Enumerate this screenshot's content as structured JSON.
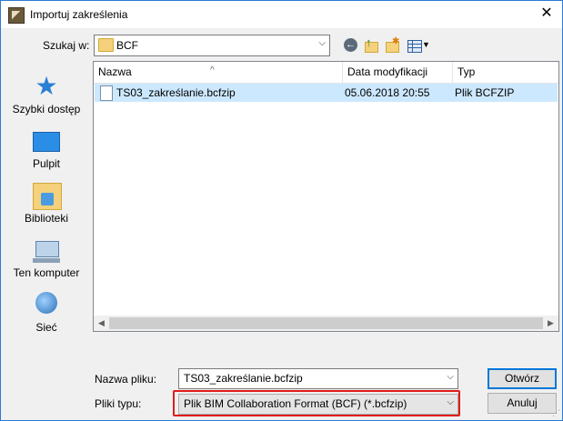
{
  "window": {
    "title": "Importuj zakreślenia",
    "close_glyph": "✕"
  },
  "toolbar": {
    "lookin_label": "Szukaj w:",
    "lookin_value": "BCF",
    "icons": [
      "back-icon",
      "up-folder-icon",
      "new-folder-icon",
      "view-menu-icon"
    ]
  },
  "places": [
    {
      "label": "Szybki dostęp",
      "icon": "quick-access-star-icon"
    },
    {
      "label": "Pulpit",
      "icon": "desktop-icon"
    },
    {
      "label": "Biblioteki",
      "icon": "libraries-icon"
    },
    {
      "label": "Ten komputer",
      "icon": "computer-icon"
    },
    {
      "label": "Sieć",
      "icon": "network-icon"
    }
  ],
  "filelist": {
    "columns": [
      "Nazwa",
      "Data modyfikacji",
      "Typ"
    ],
    "rows": [
      {
        "name": "TS03_zakreślanie.bcfzip",
        "date": "05.06.2018 20:55",
        "type": "Plik BCFZIP",
        "selected": true
      }
    ]
  },
  "footer": {
    "filename_label": "Nazwa pliku:",
    "filename_value": "TS03_zakreślanie.bcfzip",
    "filetype_label": "Pliki typu:",
    "filetype_value": "Plik BIM Collaboration Format (BCF) (*.bcfzip)",
    "open_label": "Otwórz",
    "cancel_label": "Anuluj"
  },
  "colors": {
    "selection": "#cce8ff",
    "highlight_border": "#e01b1b",
    "accent": "#0078d7"
  }
}
